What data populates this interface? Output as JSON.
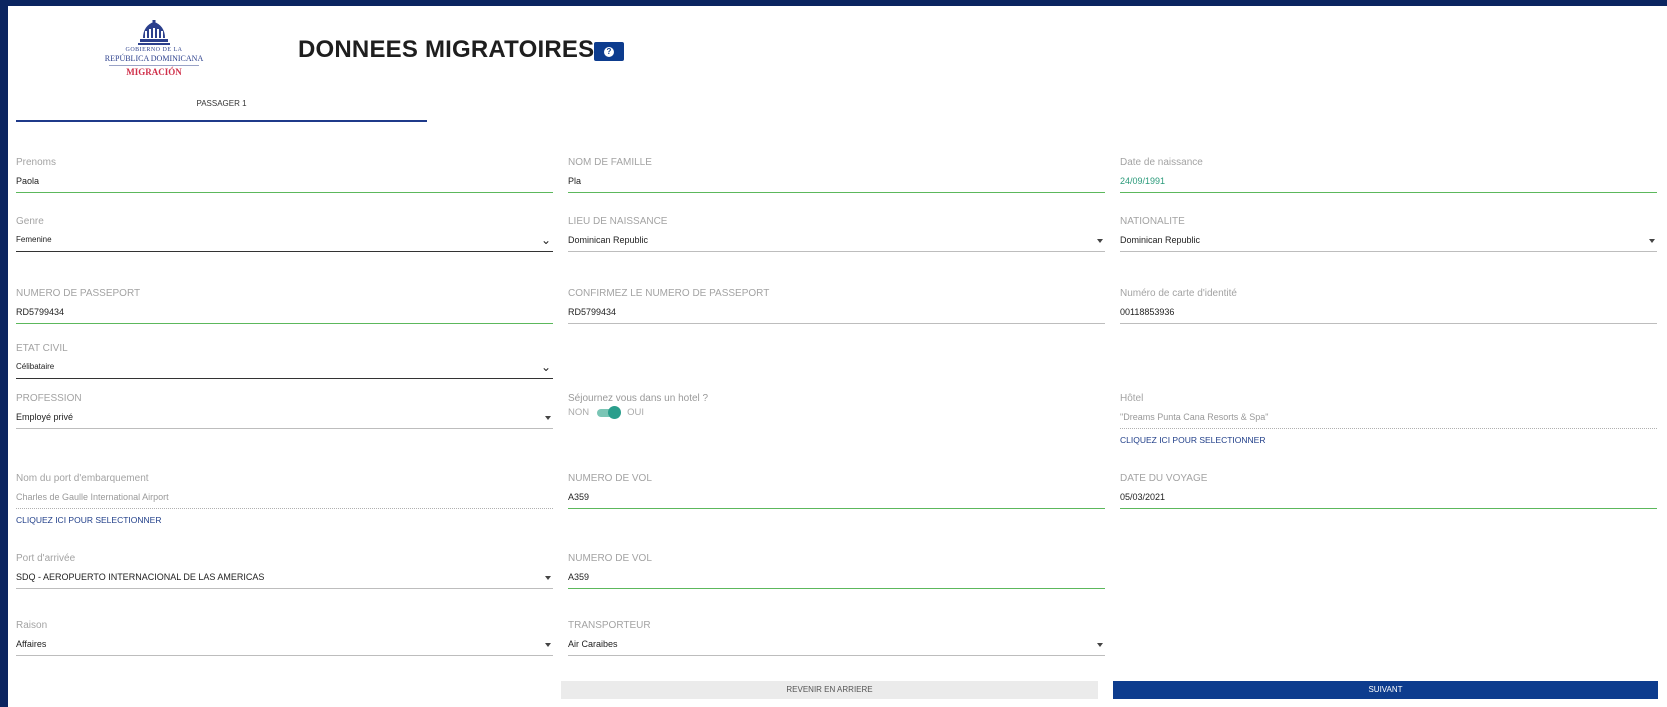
{
  "logo": {
    "line1": "GOBIERNO DE LA",
    "line2": "REPÚBLICA DOMINICANA",
    "line3": "MIGRACIÓN"
  },
  "header": {
    "title": "DONNEES MIGRATOIRES",
    "help_icon": "?"
  },
  "tabs": [
    {
      "label": "PASSAGER 1"
    }
  ],
  "form": {
    "prenoms": {
      "label": "Prenoms",
      "value": "Paola"
    },
    "nom_famille": {
      "label": "NOM DE FAMILLE",
      "value": "Pla"
    },
    "date_naissance": {
      "label": "Date de naissance",
      "value": "24/09/1991"
    },
    "genre": {
      "label": "Genre",
      "value": "Femenine"
    },
    "lieu_naissance": {
      "label": "LIEU DE NAISSANCE",
      "value": "Dominican Republic"
    },
    "nationalite": {
      "label": "NATIONALITE",
      "value": "Dominican Republic"
    },
    "passeport": {
      "label": "NUMERO DE PASSEPORT",
      "value": "RD5799434"
    },
    "confirm_passeport": {
      "label": "CONFIRMEZ LE NUMERO DE PASSEPORT",
      "value": "RD5799434"
    },
    "carte_identite": {
      "label": "Numéro de carte d'identité",
      "value": "00118853936"
    },
    "etat_civil": {
      "label": "ETAT CIVIL",
      "value": "Célibataire"
    },
    "profession": {
      "label": "PROFESSION",
      "value": "Employé privé"
    },
    "hotel_question": {
      "label": "Séjournez vous dans un hotel ?",
      "off": "NON",
      "on": "OUI",
      "checked": true
    },
    "hotel": {
      "label": "Hôtel",
      "value": "\"Dreams Punta Cana Resorts & Spa\"",
      "link": "CLIQUEZ ICI POUR SELECTIONNER"
    },
    "port_embarquement": {
      "label": "Nom du port d'embarquement",
      "value": "Charles de Gaulle International Airport",
      "link": "CLIQUEZ ICI POUR SELECTIONNER"
    },
    "numero_vol_1": {
      "label": "NUMERO DE VOL",
      "value": "A359"
    },
    "date_voyage": {
      "label": "DATE DU VOYAGE",
      "value": "05/03/2021"
    },
    "port_arrivee": {
      "label": "Port d'arrivée",
      "value": "SDQ - AEROPUERTO INTERNACIONAL DE LAS AMERICAS"
    },
    "numero_vol_2": {
      "label": "NUMERO DE VOL",
      "value": "A359"
    },
    "raison": {
      "label": "Raison",
      "value": "Affaires"
    },
    "transporteur": {
      "label": "TRANSPORTEUR",
      "value": "Air Caraibes"
    }
  },
  "actions": {
    "back_label": "REVENIR EN ARRIERE",
    "next_label": "SUIVANT"
  },
  "colors": {
    "primary": "#0d3c8e",
    "frame": "#0b2560",
    "valid": "#5cb85c",
    "toggle": "#2a9e8c"
  }
}
